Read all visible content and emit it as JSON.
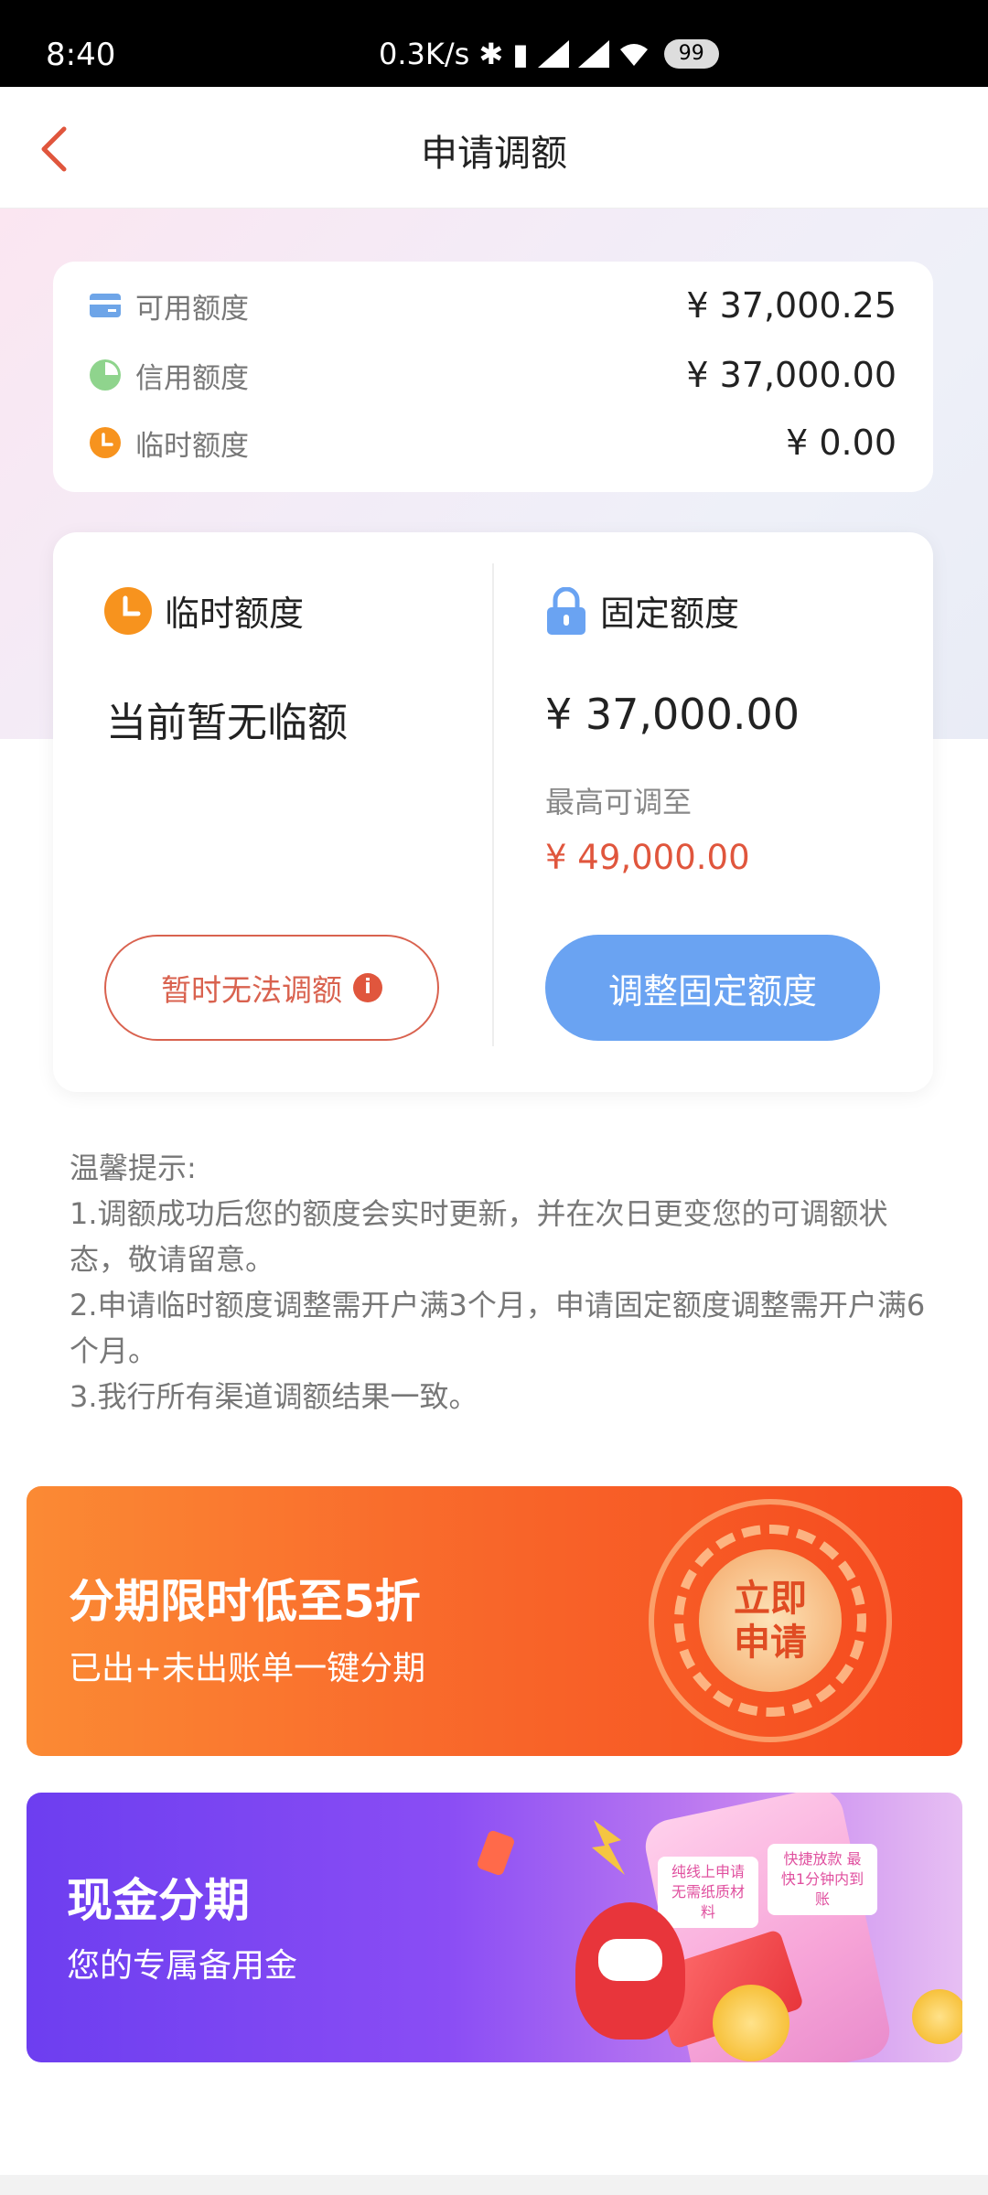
{
  "status_bar": {
    "time": "8:40",
    "speed": "0.3K/s",
    "battery": "99"
  },
  "nav": {
    "title": "申请调额"
  },
  "summary": {
    "items": [
      {
        "label": "可用额度",
        "value": "¥ 37,000.25"
      },
      {
        "label": "信用额度",
        "value": "¥ 37,000.00"
      },
      {
        "label": "临时额度",
        "value": "¥ 0.00"
      }
    ]
  },
  "temp_quota": {
    "title": "临时额度",
    "status": "当前暂无临额",
    "button": "暂时无法调额"
  },
  "fixed_quota": {
    "title": "固定额度",
    "amount": "¥ 37,000.00",
    "max_label": "最高可调至",
    "max_value": "¥ 49,000.00",
    "button": "调整固定额度"
  },
  "tips": {
    "title": "温馨提示:",
    "lines": [
      "1.调额成功后您的额度会实时更新，并在次日更变您的可调额状态，敬请留意。",
      "2.申请临时额度调整需开户满3个月，申请固定额度调整需开户满6个月。",
      "3.我行所有渠道调额结果一致。"
    ]
  },
  "banner_installment": {
    "title": "分期限时低至5折",
    "subtitle": "已出+未出账单一键分期",
    "cta": "立即申请"
  },
  "banner_cash": {
    "title": "现金分期",
    "subtitle": "您的专属备用金",
    "tag1": "纯线上申请 无需纸质材料",
    "tag2": "快捷放款 最快1分钟内到账"
  },
  "colors": {
    "accent_red": "#e0563d",
    "button_blue": "#6aa3f2",
    "orange": "#f7931e"
  }
}
